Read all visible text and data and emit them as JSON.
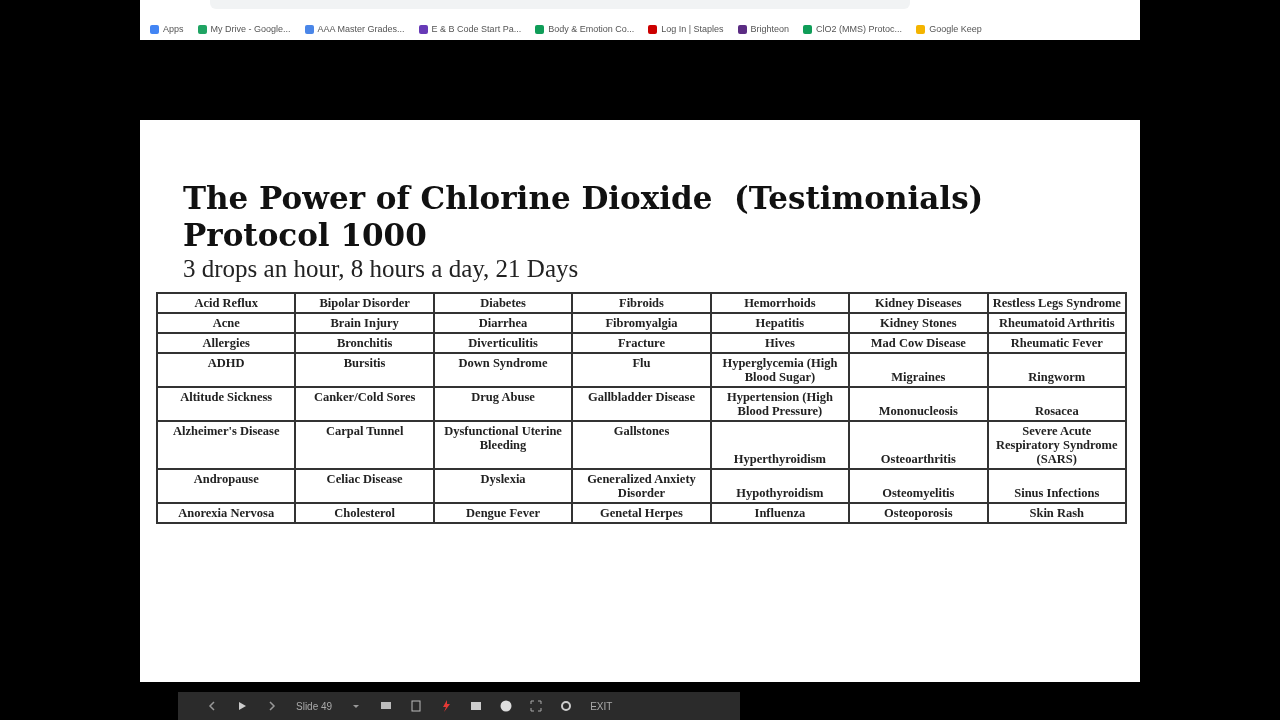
{
  "bookmarks": [
    {
      "label": "Apps",
      "color": "#4285f4"
    },
    {
      "label": "My Drive - Google...",
      "color": "#1fa463"
    },
    {
      "label": "AAA Master Grades...",
      "color": "#4a86e8"
    },
    {
      "label": "E & B Code Start Pa...",
      "color": "#673ab7"
    },
    {
      "label": "Body & Emotion Co...",
      "color": "#0f9d58"
    },
    {
      "label": "Log In | Staples",
      "color": "#cc0000"
    },
    {
      "label": "Brighteon",
      "color": "#5b2c83"
    },
    {
      "label": "ClO2 (MMS) Protoc...",
      "color": "#0f9d58"
    },
    {
      "label": "Google Keep",
      "color": "#f4b400"
    }
  ],
  "slide": {
    "title_lines": [
      "The Power of Chlorine Dioxide  (Testimonials)",
      "Protocol 1000"
    ],
    "subtitle": "3 drops an hour, 8 hours a day, 21 Days",
    "table": {
      "rows": [
        [
          "Acid Reflux",
          "Bipolar Disorder",
          "Diabetes",
          "Fibroids",
          "Hemorrhoids",
          "Kidney Diseases",
          "Restless Legs Syndrome"
        ],
        [
          "Acne",
          "Brain Injury",
          "Diarrhea",
          "Fibromyalgia",
          "Hepatitis",
          "Kidney Stones",
          "Rheumatoid Arthritis"
        ],
        [
          "Allergies",
          "Bronchitis",
          "Diverticulitis",
          "Fracture",
          "Hives",
          "Mad Cow Disease",
          "Rheumatic Fever"
        ],
        [
          "ADHD",
          "Bursitis",
          "Down Syndrome",
          "Flu",
          "Hyperglycemia (High Blood Sugar)",
          "Migraines",
          "Ringworm"
        ],
        [
          "Altitude Sickness",
          "Canker/Cold Sores",
          "Drug Abuse",
          "Gallbladder Disease",
          "Hypertension (High Blood Pressure)",
          "Mononucleosis",
          "Rosacea"
        ],
        [
          "Alzheimer's Disease",
          "Carpal Tunnel",
          "Dysfunctional Uterine Bleeding",
          "Gallstones",
          "Hyperthyroidism",
          "Osteoarthritis",
          "Severe Acute Respiratory Syndrome (SARS)"
        ],
        [
          "Andropause",
          "Celiac Disease",
          "Dyslexia",
          "Generalized Anxiety Disorder",
          "Hypothyroidism",
          "Osteomyelitis",
          "Sinus Infections"
        ],
        [
          "Anorexia Nervosa",
          "Cholesterol",
          "Dengue Fever",
          "Genetal Herpes",
          "Influenza",
          "Osteoporosis",
          "Skin Rash"
        ]
      ]
    }
  },
  "presenter_bar": {
    "slide_label": "Slide 49",
    "exit": "EXIT"
  }
}
